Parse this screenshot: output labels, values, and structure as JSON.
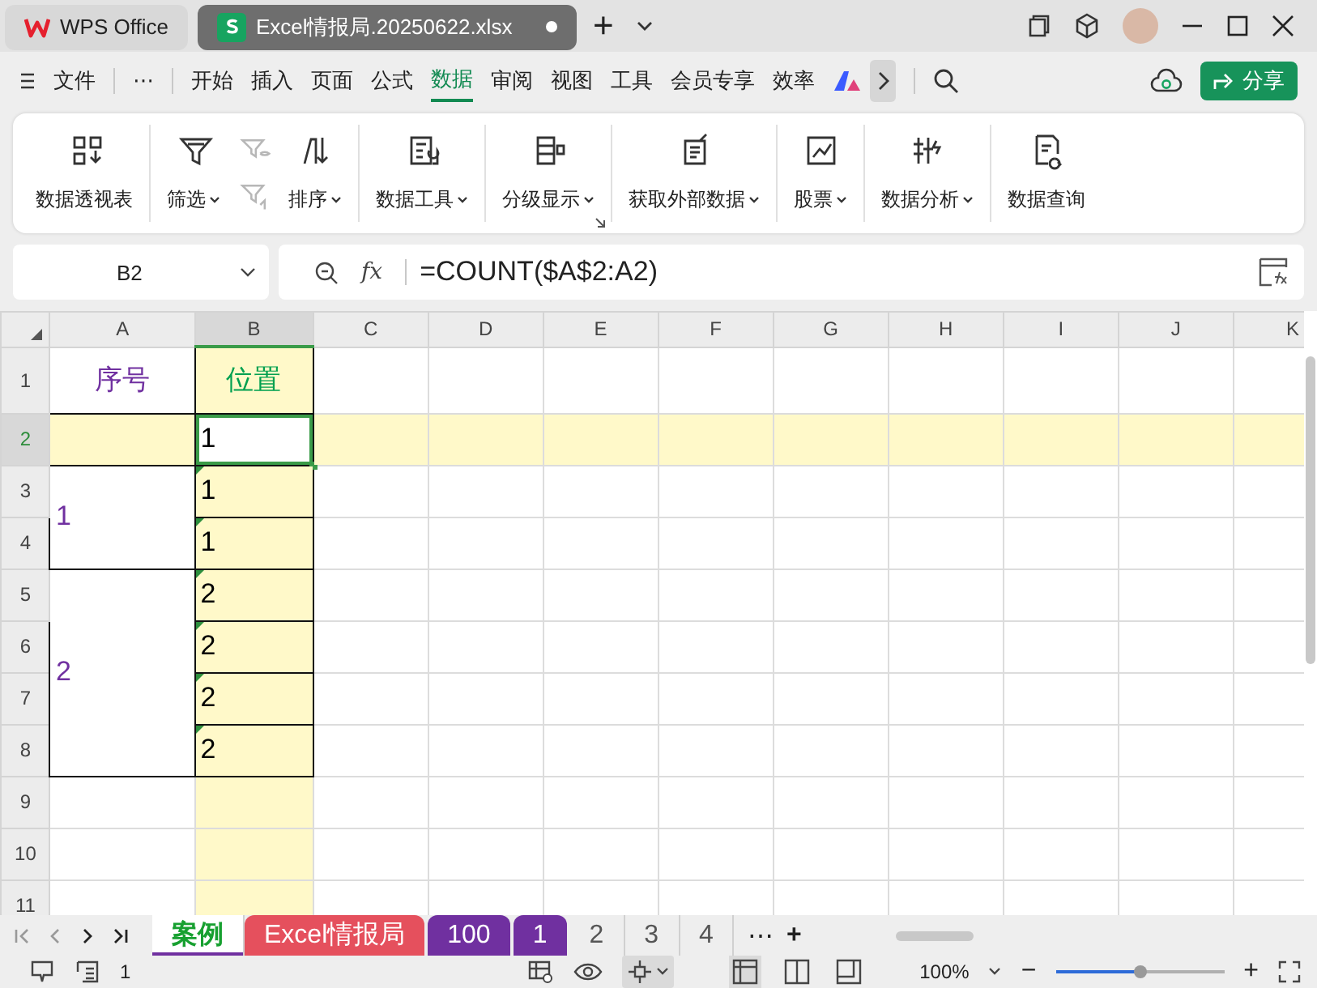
{
  "title_bar": {
    "tabs": [
      {
        "label": "WPS Office",
        "selected": false,
        "unsaved": false
      },
      {
        "label": "Excel情报局.20250622.xlsx",
        "selected": true,
        "unsaved": true
      }
    ],
    "new_tab": "+"
  },
  "menu": {
    "file": "文件",
    "more": "⋯",
    "items": [
      {
        "label": "开始",
        "selected": false
      },
      {
        "label": "插入",
        "selected": false
      },
      {
        "label": "页面",
        "selected": false
      },
      {
        "label": "公式",
        "selected": false
      },
      {
        "label": "数据",
        "selected": true
      },
      {
        "label": "审阅",
        "selected": false
      },
      {
        "label": "视图",
        "selected": false
      },
      {
        "label": "工具",
        "selected": false
      },
      {
        "label": "会员专享",
        "selected": false
      },
      {
        "label": "效率",
        "selected": false
      }
    ],
    "share": "分享"
  },
  "ribbon": [
    {
      "items": [
        {
          "kind": "large",
          "label": "数据透视表"
        }
      ]
    },
    {
      "items": [
        {
          "kind": "large",
          "label": "筛选",
          "dropdown": true
        },
        {
          "kind": "small",
          "disabled": true
        },
        {
          "kind": "small",
          "disabled": true
        },
        {
          "kind": "large",
          "label": "排序",
          "dropdown": true
        }
      ]
    },
    {
      "items": [
        {
          "kind": "large",
          "label": "数据工具",
          "dropdown": true
        }
      ]
    },
    {
      "launcher": true,
      "items": [
        {
          "kind": "large",
          "label": "分级显示",
          "dropdown": true
        }
      ]
    },
    {
      "items": [
        {
          "kind": "large",
          "label": "获取外部数据",
          "dropdown": true
        }
      ]
    },
    {
      "items": [
        {
          "kind": "large",
          "label": "股票",
          "dropdown": true
        }
      ]
    },
    {
      "items": [
        {
          "kind": "large",
          "label": "数据分析",
          "dropdown": true
        }
      ]
    },
    {
      "items": [
        {
          "kind": "large",
          "label": "数据查询"
        }
      ]
    }
  ],
  "formula_bar": {
    "name_box": "B2",
    "fx": "fx",
    "formula": "=COUNT($A$2:A2)"
  },
  "sheet": {
    "columns": [
      {
        "label": "A",
        "selected": false
      },
      {
        "label": "B",
        "selected": true
      },
      {
        "label": "C",
        "selected": false
      },
      {
        "label": "D",
        "selected": false
      },
      {
        "label": "E",
        "selected": false
      },
      {
        "label": "F",
        "selected": false
      },
      {
        "label": "G",
        "selected": false
      },
      {
        "label": "H",
        "selected": false
      },
      {
        "label": "I",
        "selected": false
      },
      {
        "label": "J",
        "selected": false
      },
      {
        "label": "K",
        "selected": false
      }
    ],
    "rows": [
      {
        "header": "1",
        "selected": false,
        "cells": [
          {
            "kind": "heading",
            "text": "序号",
            "color": "#7030a0",
            "active": false,
            "flag": false
          },
          {
            "kind": "heading",
            "text": "位置",
            "color": "#00a050",
            "active": false,
            "flag": false
          }
        ]
      },
      {
        "header": "2",
        "selected": true,
        "cells": [
          {
            "kind": "value",
            "active": false,
            "flag": false
          },
          {
            "kind": "value",
            "text": "1",
            "color": "#000000",
            "active": true,
            "flag": false
          }
        ]
      },
      {
        "header": "3",
        "selected": false,
        "cells": [
          {
            "kind": "value",
            "text": "1",
            "color": "#7030a0",
            "active": false,
            "flag": false
          },
          {
            "kind": "value",
            "text": "1",
            "color": "#000000",
            "active": false,
            "flag": true
          }
        ]
      },
      {
        "header": "4",
        "selected": false,
        "cells": [
          {
            "kind": "merged"
          },
          {
            "kind": "value",
            "text": "1",
            "color": "#000000",
            "active": false,
            "flag": true
          }
        ]
      },
      {
        "header": "5",
        "selected": false,
        "cells": [
          {
            "kind": "value",
            "text": "2",
            "color": "#7030a0",
            "active": false,
            "flag": false
          },
          {
            "kind": "value",
            "text": "2",
            "color": "#000000",
            "active": false,
            "flag": true
          }
        ]
      },
      {
        "header": "6",
        "selected": false,
        "cells": [
          {
            "kind": "merged"
          },
          {
            "kind": "value",
            "text": "2",
            "color": "#000000",
            "active": false,
            "flag": true
          }
        ]
      },
      {
        "header": "7",
        "selected": false,
        "cells": [
          {
            "kind": "merged"
          },
          {
            "kind": "value",
            "text": "2",
            "color": "#000000",
            "active": false,
            "flag": true
          }
        ]
      },
      {
        "header": "8",
        "selected": false,
        "cells": [
          {
            "kind": "merged"
          },
          {
            "kind": "value",
            "text": "2",
            "color": "#000000",
            "active": false,
            "flag": true
          }
        ]
      },
      {
        "header": "9",
        "selected": false
      },
      {
        "header": "10",
        "selected": false
      },
      {
        "header": "11",
        "selected": false
      }
    ]
  },
  "sheet_tabs": {
    "more": "⋯",
    "add": "+",
    "tabs": [
      {
        "label": "案例",
        "selected": true
      },
      {
        "label": "Excel情报局",
        "selected": false,
        "color": "#e5505d"
      },
      {
        "label": "100",
        "selected": false,
        "color": "#7030a0"
      },
      {
        "label": "1",
        "selected": false,
        "color": "#7030a0"
      },
      {
        "label": "2",
        "selected": false
      },
      {
        "label": "3",
        "selected": false
      },
      {
        "label": "4",
        "selected": false
      }
    ]
  },
  "status_bar": {
    "count": "1",
    "zoom": "100%",
    "zoom_slider": {
      "level": 0.5
    },
    "minus": "−",
    "plus": "+"
  }
}
